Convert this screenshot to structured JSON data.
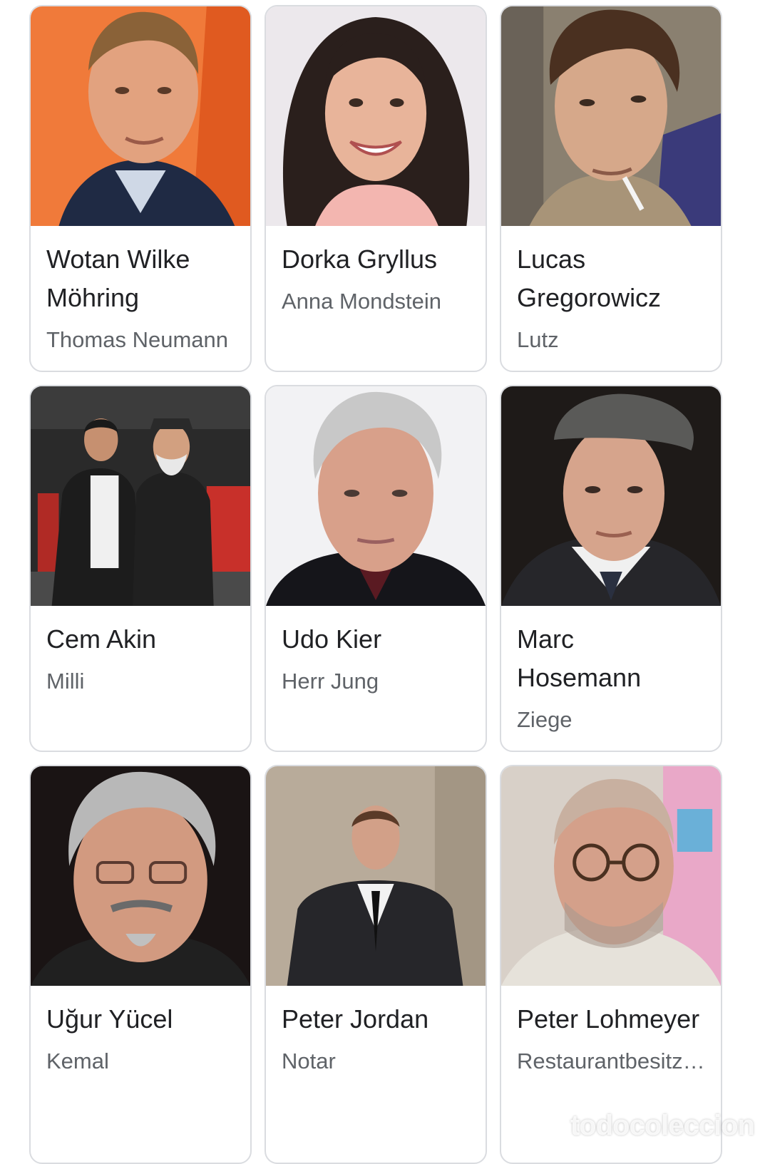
{
  "cast": [
    {
      "name": "Wotan Wilke Möhring",
      "role": "Thomas Neumann",
      "photo": "portrait-man-orange-bg"
    },
    {
      "name": "Dorka Gryllus",
      "role": "Anna Mondstein",
      "photo": "portrait-woman-dark-hair"
    },
    {
      "name": "Lucas Gregorowicz",
      "role": "Lutz",
      "photo": "portrait-man-cigarette"
    },
    {
      "name": "Cem Akin",
      "role": "Milli",
      "photo": "photo-two-men-red-carpet"
    },
    {
      "name": "Udo Kier",
      "role": "Herr Jung",
      "photo": "portrait-older-man-grey-hair"
    },
    {
      "name": "Marc Hosemann",
      "role": "Ziege",
      "photo": "portrait-man-flat-cap"
    },
    {
      "name": "Uğur Yücel",
      "role": "Kemal",
      "photo": "portrait-man-glasses-goatee"
    },
    {
      "name": "Peter Jordan",
      "role": "Notar",
      "photo": "photo-man-black-suit"
    },
    {
      "name": "Peter Lohmeyer",
      "role": "Restaurantbesitz…",
      "photo": "portrait-man-round-glasses"
    }
  ],
  "watermark": "todocoleccion",
  "colors": {
    "border": "#dadce0",
    "name_text": "#202124",
    "role_text": "#5f6368"
  }
}
